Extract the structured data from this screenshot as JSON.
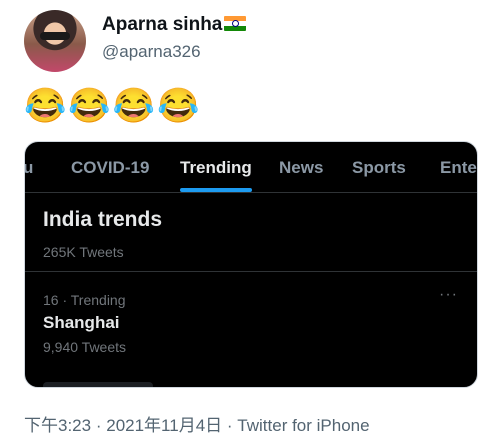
{
  "tweet": {
    "author_name": "Aparna sinha",
    "author_handle": "@aparna326",
    "text": "😂😂😂😂",
    "time": "下午3:23",
    "separator": "·",
    "date": "2021年11月4日",
    "source": "Twitter for iPhone"
  },
  "media": {
    "tabs": [
      {
        "label": "u"
      },
      {
        "label": "COVID-19"
      },
      {
        "label": "Trending"
      },
      {
        "label": "News"
      },
      {
        "label": "Sports"
      },
      {
        "label": "Ente"
      }
    ],
    "active_tab": "Trending",
    "section_title": "India trends",
    "trend_prev_count": "265K Tweets",
    "trend": {
      "meta": "16 · Trending",
      "name": "Shanghai",
      "count": "9,940 Tweets",
      "more": "···"
    }
  },
  "colors": {
    "accent": "#1d9bf0",
    "dark_bg": "#000000"
  },
  "icons": [
    "india-flag-icon",
    "more-options-icon"
  ]
}
